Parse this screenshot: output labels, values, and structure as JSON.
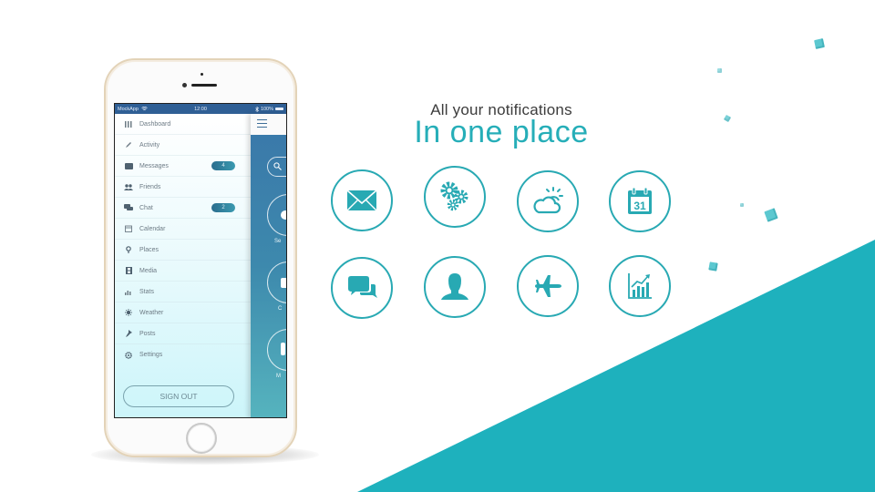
{
  "colors": {
    "accent": "#1eb1bd",
    "title": "#26aeb8",
    "icon": "#28a9b3",
    "statusbar": "#2f5f95"
  },
  "headline": {
    "subtitle": "All your notifications",
    "title": "In one place"
  },
  "features": [
    {
      "name": "mail",
      "icon": "envelope-icon"
    },
    {
      "name": "settings",
      "icon": "gears-icon"
    },
    {
      "name": "weather",
      "icon": "partly-cloudy-icon"
    },
    {
      "name": "calendar",
      "icon": "calendar-icon",
      "label": "31"
    },
    {
      "name": "chat",
      "icon": "chat-bubbles-icon"
    },
    {
      "name": "profile",
      "icon": "user-icon"
    },
    {
      "name": "travel",
      "icon": "airplane-icon"
    },
    {
      "name": "stats",
      "icon": "growth-chart-icon"
    }
  ],
  "phone": {
    "statusbar": {
      "carrier": "MockApp",
      "time": "12:00",
      "battery": "100%"
    },
    "menu": {
      "items": [
        {
          "label": "Dashboard",
          "icon": "grid-icon"
        },
        {
          "label": "Activity",
          "icon": "pencil-icon"
        },
        {
          "label": "Messages",
          "icon": "message-icon",
          "badge": "4"
        },
        {
          "label": "Friends",
          "icon": "friends-icon"
        },
        {
          "label": "Chat",
          "icon": "chat-icon",
          "badge": "2"
        },
        {
          "label": "Calendar",
          "icon": "calendar-icon"
        },
        {
          "label": "Places",
          "icon": "map-pin-icon"
        },
        {
          "label": "Media",
          "icon": "film-icon"
        },
        {
          "label": "Stats",
          "icon": "bar-chart-icon"
        },
        {
          "label": "Weather",
          "icon": "sun-icon"
        },
        {
          "label": "Posts",
          "icon": "pin-icon"
        },
        {
          "label": "Settings",
          "icon": "gear-icon"
        }
      ],
      "sign_out": "SIGN OUT"
    },
    "main": {
      "buttons": [
        {
          "label": "Se"
        },
        {
          "label": "C"
        },
        {
          "label": "M"
        }
      ]
    }
  }
}
